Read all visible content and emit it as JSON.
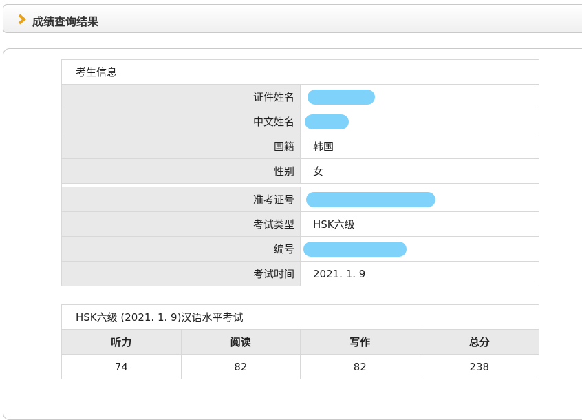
{
  "header": {
    "title": "成绩查询结果"
  },
  "candidate": {
    "section_title": "考生信息",
    "rows": [
      {
        "label": "证件姓名",
        "value": ""
      },
      {
        "label": "中文姓名",
        "value": ""
      },
      {
        "label": "国籍",
        "value": "韩国"
      },
      {
        "label": "性别",
        "value": "女"
      },
      {
        "label": "准考证号",
        "value": ""
      },
      {
        "label": "考试类型",
        "value": "HSK六级"
      },
      {
        "label": "编号",
        "value": ""
      },
      {
        "label": "考试时间",
        "value": "2021. 1. 9"
      }
    ]
  },
  "scores": {
    "caption": "HSK六级 (2021. 1. 9)汉语水平考试",
    "columns": [
      "听力",
      "阅读",
      "写作",
      "总分"
    ],
    "values": [
      "74",
      "82",
      "82",
      "238"
    ]
  },
  "colors": {
    "redaction": "#7fd3fb",
    "chevron": "#e8a21a",
    "label_bg": "#e9e9e9"
  },
  "icons": {
    "header": "chevron-right-icon"
  }
}
